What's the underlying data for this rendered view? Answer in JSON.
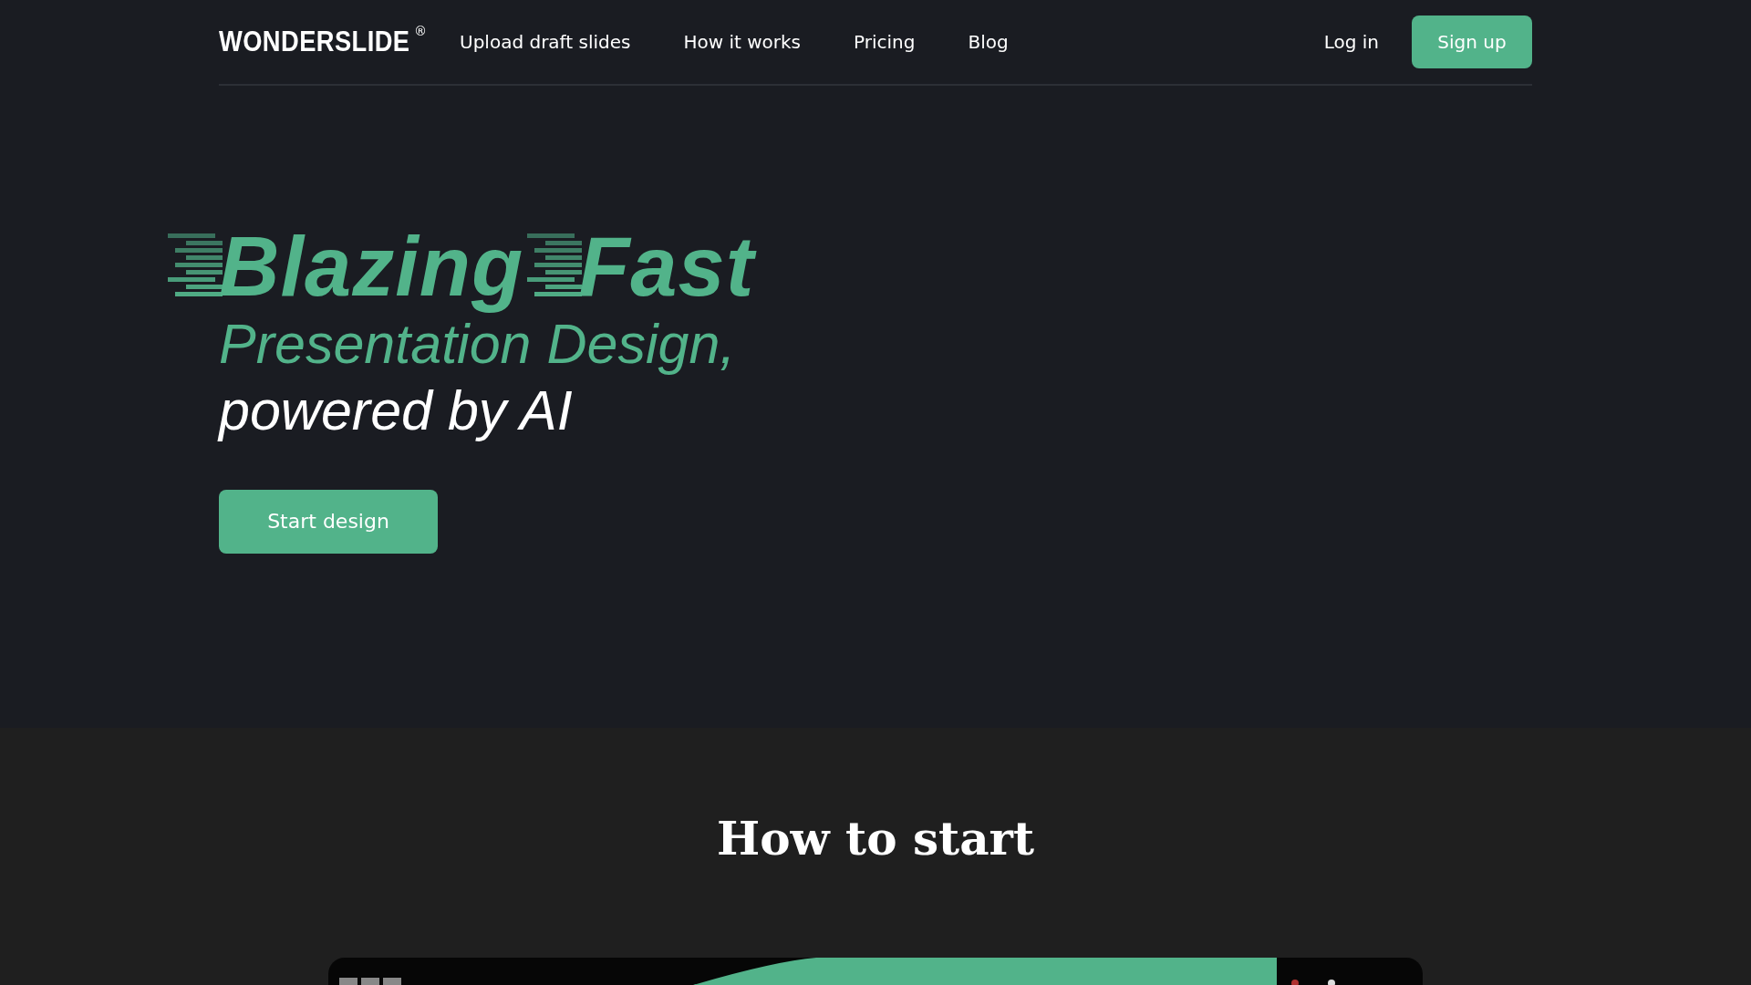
{
  "header": {
    "logo": "WONDERSLIDE",
    "logo_mark": "®",
    "nav": [
      {
        "label": "Upload draft slides"
      },
      {
        "label": "How it works"
      },
      {
        "label": "Pricing"
      },
      {
        "label": "Blog"
      }
    ],
    "login": "Log in",
    "signup": "Sign up"
  },
  "hero": {
    "title_words": [
      "Blazing",
      "Fast"
    ],
    "subtitle": "Presentation Design,",
    "tagline": "powered by AI",
    "cta": "Start design"
  },
  "how_to_start": {
    "heading": "How to start"
  }
}
